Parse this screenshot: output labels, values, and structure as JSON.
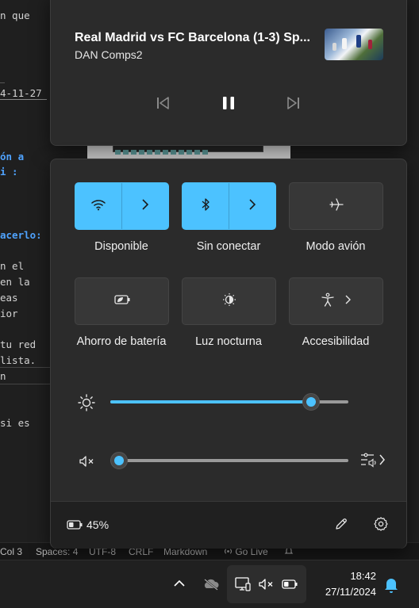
{
  "editor": {
    "lines": [
      {
        "text": "n que",
        "style": "normal"
      },
      {
        "text": "4-11-27",
        "style": "underlined"
      },
      {
        "text": "ón a",
        "style": "blue"
      },
      {
        "text": "i :",
        "style": "blue"
      },
      {
        "text": "acerlo:",
        "style": "blue"
      },
      {
        "text": "n el",
        "style": "normal"
      },
      {
        "text": " en la",
        "style": "normal"
      },
      {
        "text": "eas",
        "style": "normal"
      },
      {
        "text": "ior",
        "style": "normal"
      },
      {
        "text": " tu red",
        "style": "normal"
      },
      {
        "text": "lista.",
        "style": "normal"
      },
      {
        "text": "n",
        "style": "normal"
      },
      {
        "text": "si es",
        "style": "normal"
      }
    ]
  },
  "statusbar": {
    "position": "Col 3",
    "spaces": "Spaces: 4",
    "encoding": "UTF-8",
    "eol": "CRLF",
    "language": "Markdown",
    "golive": "Go Live"
  },
  "media": {
    "title": "Real Madrid vs FC Barcelona (1-3) Sp...",
    "artist": "DAN Comps2",
    "prev_icon": "previous-track-icon",
    "play_icon": "pause-icon",
    "next_icon": "next-track-icon"
  },
  "quick_settings": {
    "tiles": [
      {
        "label": "Disponible",
        "icon": "wifi-icon",
        "active": true,
        "split": true
      },
      {
        "label": "Sin conectar",
        "icon": "bluetooth-icon",
        "active": true,
        "split": true
      },
      {
        "label": "Modo avión",
        "icon": "airplane-icon",
        "active": false,
        "split": false
      },
      {
        "label": "Ahorro de batería",
        "icon": "battery-saver-icon",
        "active": false,
        "split": false
      },
      {
        "label": "Luz nocturna",
        "icon": "night-light-icon",
        "active": false,
        "split": false
      },
      {
        "label": "Accesibilidad",
        "icon": "accessibility-icon",
        "active": false,
        "split": false
      }
    ],
    "brightness_level": 0.87,
    "volume_level": 0.0,
    "battery_percent": "45%"
  },
  "taskbar": {
    "time": "18:42",
    "date": "27/11/2024"
  },
  "colors": {
    "accent": "#4cc2ff",
    "panel": "#2b2b2b",
    "footer": "#202020"
  }
}
